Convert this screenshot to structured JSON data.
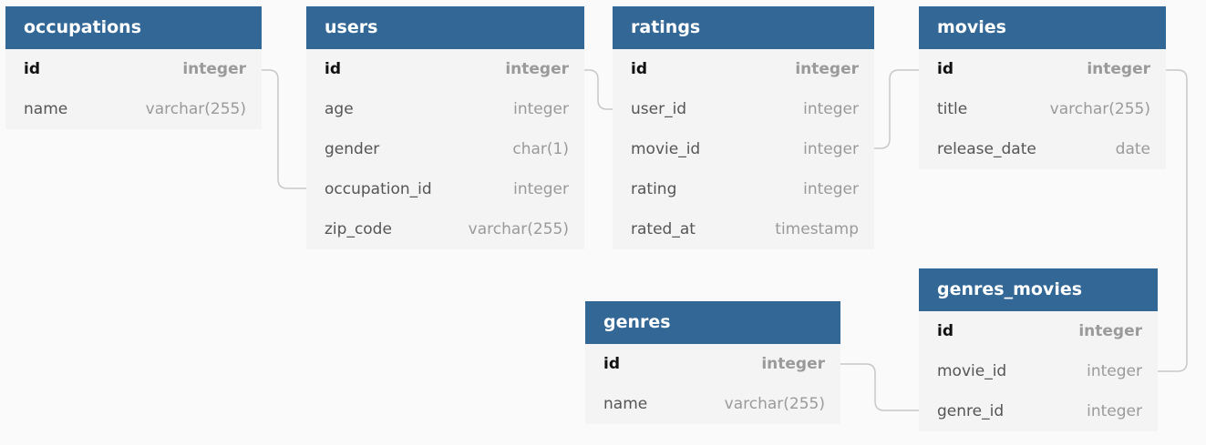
{
  "colors": {
    "header_bg": "#326796",
    "header_text": "#ffffff",
    "body_bg": "#f4f4f4",
    "canvas_bg": "#fafafa",
    "connector": "#c8c8c8"
  },
  "tables": {
    "occupations": {
      "title": "occupations",
      "columns": [
        {
          "name": "id",
          "type": "integer",
          "primary_key": true
        },
        {
          "name": "name",
          "type": "varchar(255)",
          "primary_key": false
        }
      ]
    },
    "users": {
      "title": "users",
      "columns": [
        {
          "name": "id",
          "type": "integer",
          "primary_key": true
        },
        {
          "name": "age",
          "type": "integer",
          "primary_key": false
        },
        {
          "name": "gender",
          "type": "char(1)",
          "primary_key": false
        },
        {
          "name": "occupation_id",
          "type": "integer",
          "primary_key": false
        },
        {
          "name": "zip_code",
          "type": "varchar(255)",
          "primary_key": false
        }
      ]
    },
    "ratings": {
      "title": "ratings",
      "columns": [
        {
          "name": "id",
          "type": "integer",
          "primary_key": true
        },
        {
          "name": "user_id",
          "type": "integer",
          "primary_key": false
        },
        {
          "name": "movie_id",
          "type": "integer",
          "primary_key": false
        },
        {
          "name": "rating",
          "type": "integer",
          "primary_key": false
        },
        {
          "name": "rated_at",
          "type": "timestamp",
          "primary_key": false
        }
      ]
    },
    "movies": {
      "title": "movies",
      "columns": [
        {
          "name": "id",
          "type": "integer",
          "primary_key": true
        },
        {
          "name": "title",
          "type": "varchar(255)",
          "primary_key": false
        },
        {
          "name": "release_date",
          "type": "date",
          "primary_key": false
        }
      ]
    },
    "genres_movies": {
      "title": "genres_movies",
      "columns": [
        {
          "name": "id",
          "type": "integer",
          "primary_key": true
        },
        {
          "name": "movie_id",
          "type": "integer",
          "primary_key": false
        },
        {
          "name": "genre_id",
          "type": "integer",
          "primary_key": false
        }
      ]
    },
    "genres": {
      "title": "genres",
      "columns": [
        {
          "name": "id",
          "type": "integer",
          "primary_key": true
        },
        {
          "name": "name",
          "type": "varchar(255)",
          "primary_key": false
        }
      ]
    }
  },
  "relations": [
    {
      "from": "occupations.id",
      "to": "users.occupation_id"
    },
    {
      "from": "users.id",
      "to": "ratings.user_id"
    },
    {
      "from": "ratings.movie_id",
      "to": "movies.id"
    },
    {
      "from": "movies.id",
      "to": "genres_movies.movie_id"
    },
    {
      "from": "genres.id",
      "to": "genres_movies.genre_id"
    }
  ]
}
